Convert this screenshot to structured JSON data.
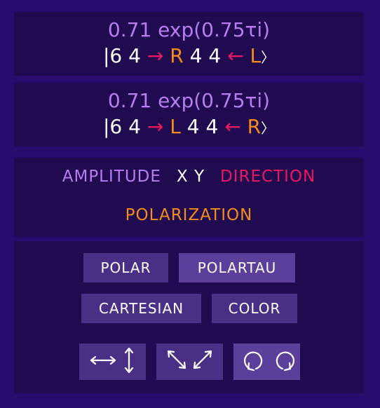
{
  "states": [
    {
      "amplitude": "0.71 exp(0.75τi)",
      "ket_open": "|",
      "pos_x": "6",
      "pos_y": "4",
      "dir_symbol": "→",
      "polarization": "R",
      "pos_x2": "4",
      "pos_y2": "4",
      "dir_symbol2": "←",
      "polarization2": "L",
      "ket_close": "〉"
    },
    {
      "amplitude": "0.71 exp(0.75τi)",
      "ket_open": "|",
      "pos_x": "6",
      "pos_y": "4",
      "dir_symbol": "→",
      "polarization": "L",
      "pos_x2": "4",
      "pos_y2": "4",
      "dir_symbol2": "←",
      "polarization2": "R",
      "ket_close": "〉"
    }
  ],
  "legend": {
    "amplitude": "AMPLITUDE",
    "xy": "X Y",
    "direction": "DIRECTION",
    "polarization": "POLARIZATION"
  },
  "controls": {
    "polar": "POLAR",
    "polartau": "POLARTAU",
    "cartesian": "CARTESIAN",
    "color": "COLOR",
    "basis_icons": [
      "horizontal-vertical-arrows-icon",
      "diagonal-arrows-icon",
      "circular-arrows-icon"
    ]
  },
  "colors": {
    "background": "#2a0c6e",
    "panel": "#200b51",
    "amplitude": "#b77cf0",
    "direction": "#e8195f",
    "polarization": "#f28c1a",
    "button": "#4a2f86",
    "button_active": "#5c3f9a"
  }
}
